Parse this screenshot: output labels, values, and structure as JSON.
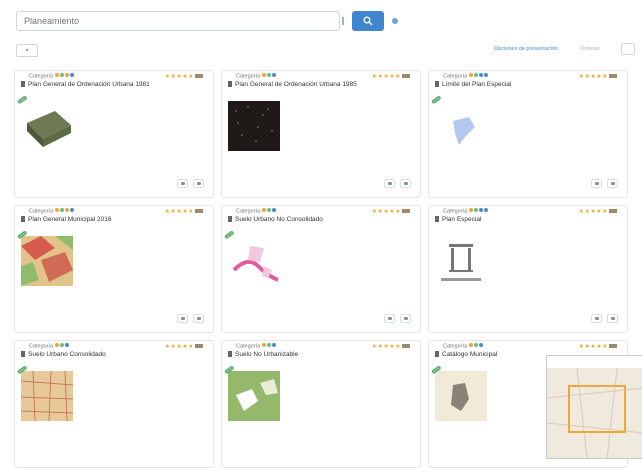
{
  "search": {
    "placeholder": "Planeamiento"
  },
  "toolbar": {
    "filter_label": "",
    "link_primary": "Opciones de presentación",
    "link_secondary": "Ordenar"
  },
  "cards": [
    {
      "category": "Categoría",
      "title": "Plan General de Ordenación Urbana 1981"
    },
    {
      "category": "Categoría",
      "title": "Plan General de Ordenación Urbana 1985"
    },
    {
      "category": "Categoría",
      "title": "Límite del Plan Especial"
    },
    {
      "category": "Categoría",
      "title": "Plan General Municipal 2016"
    },
    {
      "category": "Categoría",
      "title": "Suelo Urbano No Consolidado"
    },
    {
      "category": "Categoría",
      "title": "Plan Especial"
    },
    {
      "category": "Categoría",
      "title": "Suelo Urbano Consolidado"
    },
    {
      "category": "Categoría",
      "title": "Suelo No Urbanizable"
    },
    {
      "category": "Categoría",
      "title": "Catálogo Municipal"
    }
  ],
  "colors": {
    "accent": "#3f86cf",
    "badge": "#7cc48a",
    "star": "#f0a63a"
  }
}
